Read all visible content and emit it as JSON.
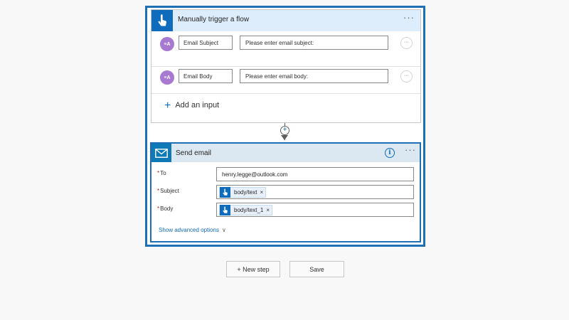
{
  "trigger": {
    "title": "Manually trigger a flow",
    "menu": "···",
    "inputs": [
      {
        "avatar": "≡A",
        "name": "Email Subject",
        "description": "Please enter email subject:",
        "menu": "···"
      },
      {
        "avatar": "≡A",
        "name": "Email Body",
        "description": "Please enter email body:",
        "menu": "···"
      }
    ],
    "add_input_label": "Add an input"
  },
  "connector": {
    "plus": "+"
  },
  "action": {
    "title": "Send email",
    "menu": "···",
    "info": "i",
    "fields": [
      {
        "label": "To",
        "required": "*",
        "value": "henry.legge@outlook.com"
      },
      {
        "label": "Subject",
        "required": "*",
        "token": "body/text",
        "remove": "×"
      },
      {
        "label": "Body",
        "required": "*",
        "token": "body/text_1",
        "remove": "×"
      }
    ],
    "advanced_label": "Show advanced options"
  },
  "buttons": {
    "new_step": "+ New step",
    "save": "Save"
  },
  "colors": {
    "accent": "#0f6cbd",
    "selection_border": "#1f6fb5",
    "avatar": "#a879d1"
  },
  "icons": {
    "trigger": "hand-pointer-icon",
    "action": "envelope-icon"
  }
}
